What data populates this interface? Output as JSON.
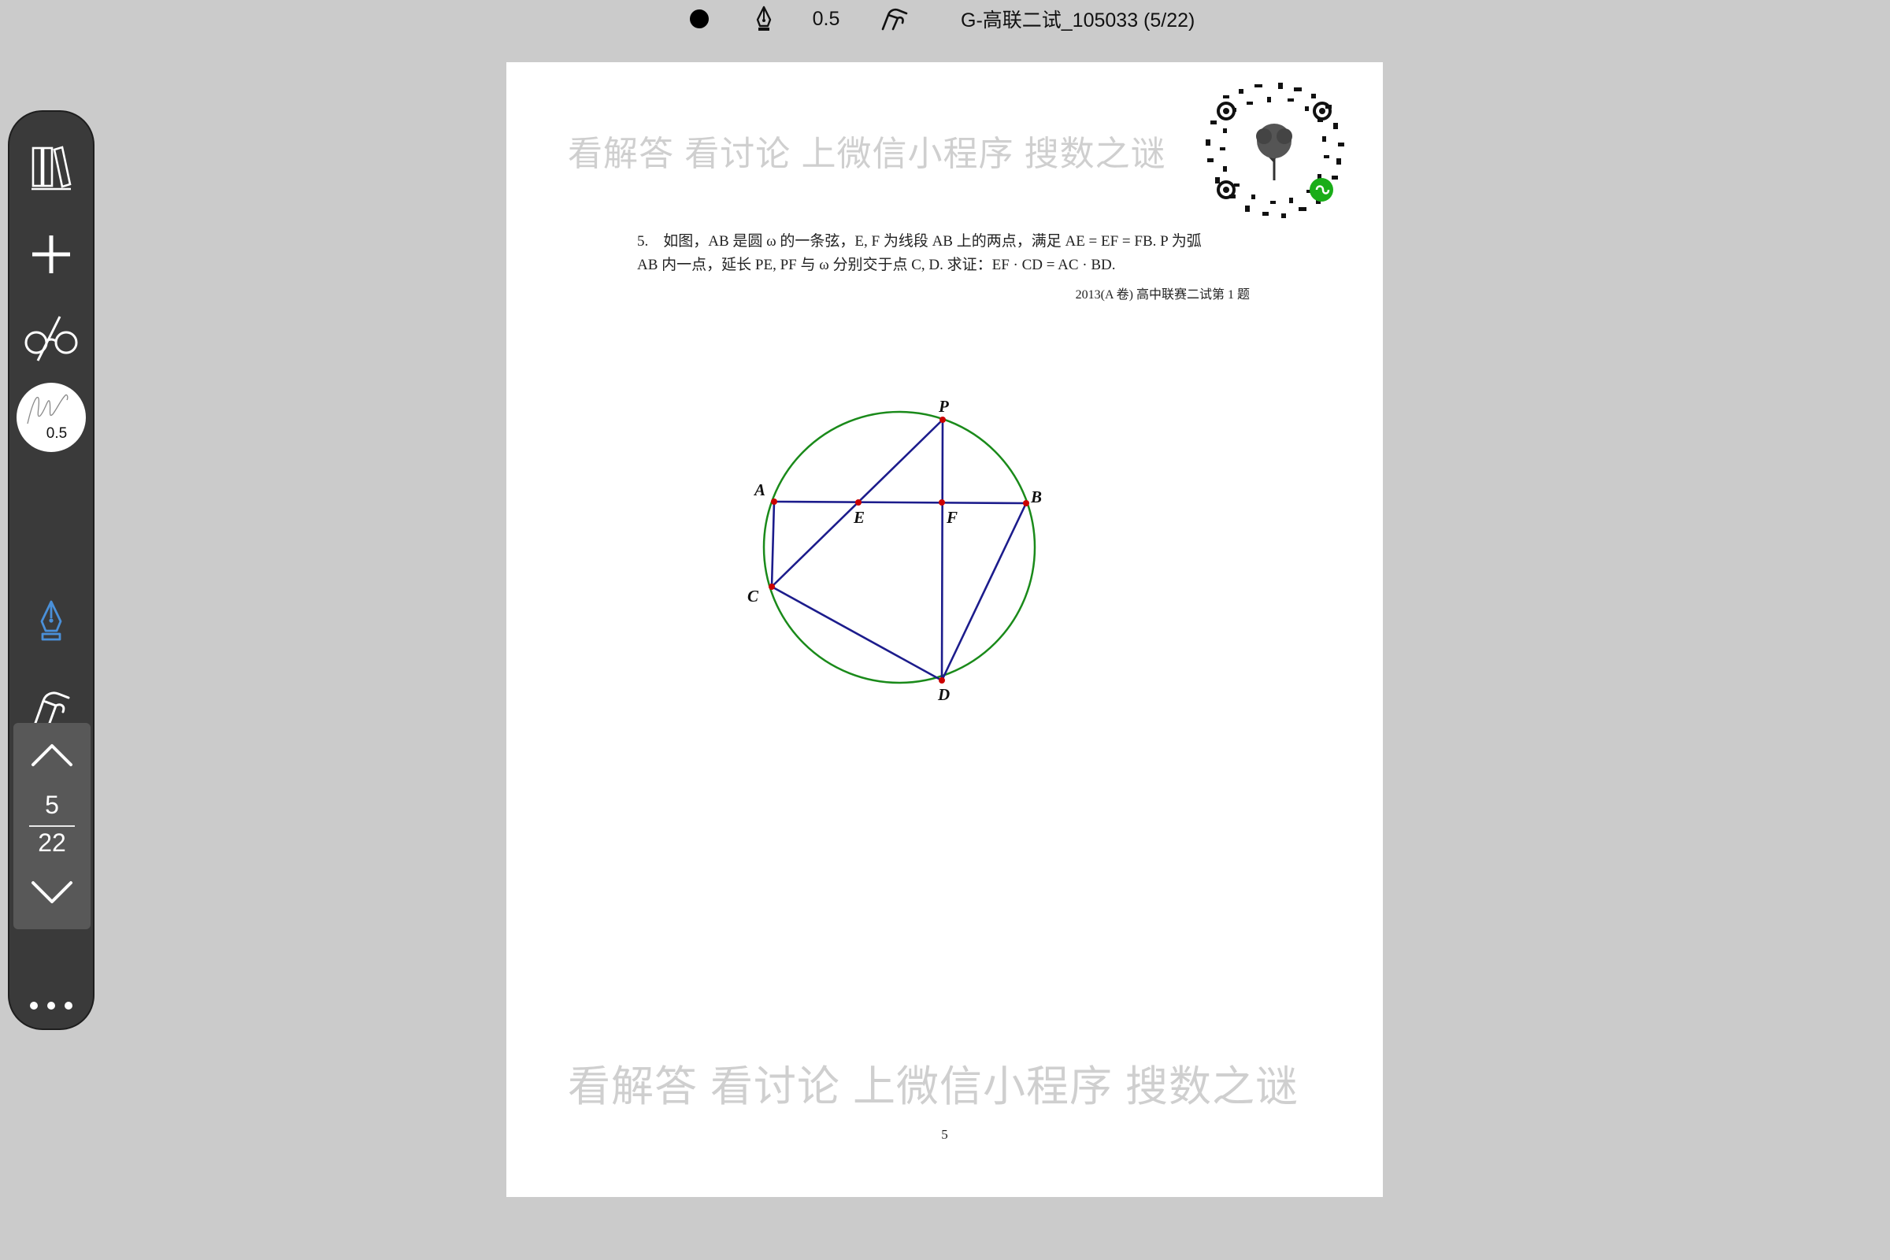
{
  "toolbar": {
    "color_icon": "filled-circle",
    "pen_icon": "fountain-pen",
    "stroke_width": "0.5",
    "signature_icon": "signature-hand",
    "document_title": "G-高联二试_105033 (5/22)"
  },
  "sidebar": {
    "icons": [
      "library",
      "plus",
      "glasses",
      "pen-size",
      "fountain-pen",
      "signature",
      "undo",
      "chevron-up",
      "chevron-down",
      "more"
    ],
    "pen_size_label": "0.5",
    "accent_color": "#4a90d9",
    "current_page": "5",
    "total_pages": "22"
  },
  "document": {
    "watermark_top": "看解答 看讨论 上微信小程序 搜数之谜",
    "watermark_bottom": "看解答 看讨论 上微信小程序 搜数之谜",
    "problem_line1": "5.　如图，AB 是圆 ω 的一条弦，E, F 为线段 AB 上的两点，满足 AE = EF = FB. P 为弧",
    "problem_line2": "AB 内一点，延长 PE, PF 与 ω 分别交于点 C, D. 求证：EF · CD = AC · BD.",
    "source": "2013(A 卷) 高中联赛二试第 1 题",
    "figure_labels": {
      "P": "P",
      "A": "A",
      "B": "B",
      "E": "E",
      "F": "F",
      "C": "C",
      "D": "D"
    },
    "page_number": "5"
  },
  "colors": {
    "circle": "#1a8a1a",
    "segments": "#1c1c8c",
    "points": "#cc0000",
    "background": "#cbcbcb"
  }
}
